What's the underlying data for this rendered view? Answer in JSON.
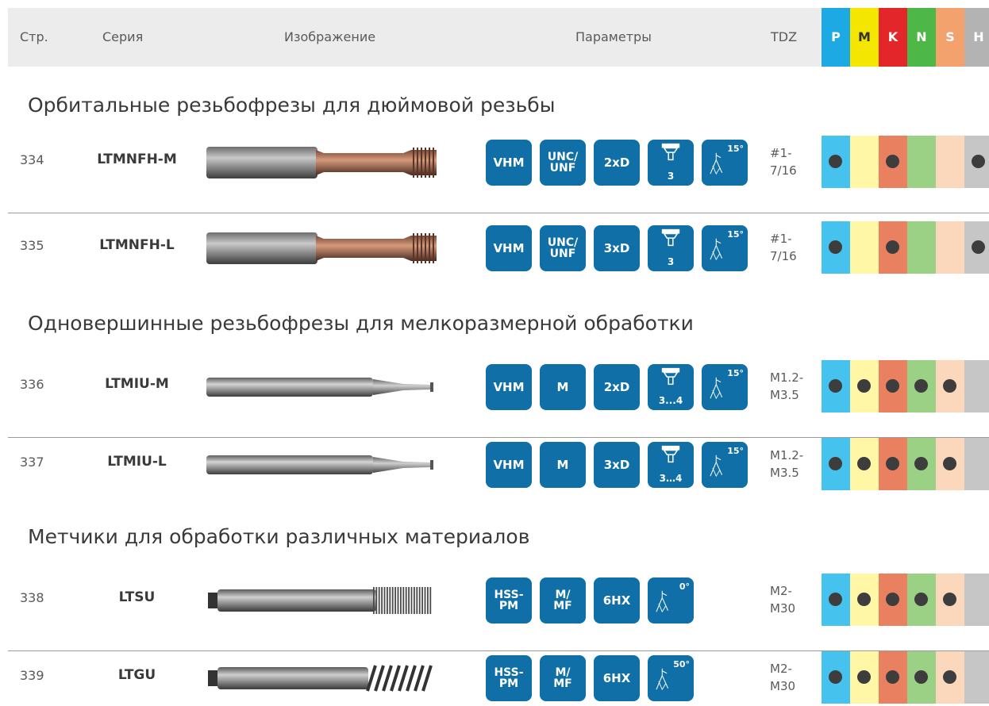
{
  "header": {
    "page": "Стр.",
    "series": "Серия",
    "image": "Изображение",
    "params": "Параметры",
    "tdz": "TDZ",
    "materials": [
      "P",
      "M",
      "K",
      "N",
      "S",
      "H"
    ]
  },
  "colors": {
    "head": [
      "#1ca9e4",
      "#f5e600",
      "#e3262a",
      "#4db848",
      "#f4a26d",
      "#b3b3b3"
    ],
    "cell": [
      "#45c3ee",
      "#fff6a6",
      "#e9805f",
      "#9bd185",
      "#fbd8bc",
      "#c6c6c6"
    ],
    "badge": "#0f6fa6"
  },
  "sections": [
    {
      "title": "Орбитальные резьбофрезы для дюймовой резьбы"
    },
    {
      "title": "Одновершинные резьбофрезы для мелкоразмерной обработки"
    },
    {
      "title": "Метчики для обработки различных материалов"
    }
  ],
  "rows": [
    {
      "page": "334",
      "series": "LTMNFH-M",
      "tool_icon": "thread-mill-icon",
      "badges": [
        "VHM",
        "UNC/ UNF",
        "2xD"
      ],
      "flutes": "3",
      "angle": "15°",
      "tdz": [
        "#1-",
        "7/16"
      ],
      "dots": [
        true,
        false,
        true,
        false,
        false,
        true
      ]
    },
    {
      "page": "335",
      "series": "LTMNFH-L",
      "tool_icon": "thread-mill-icon",
      "badges": [
        "VHM",
        "UNC/ UNF",
        "3xD"
      ],
      "flutes": "3",
      "angle": "15°",
      "tdz": [
        "#1-",
        "7/16"
      ],
      "dots": [
        true,
        false,
        true,
        false,
        false,
        true
      ]
    },
    {
      "page": "336",
      "series": "LTMIU-M",
      "tool_icon": "single-point-mill-icon",
      "badges": [
        "VHM",
        "M",
        "2xD"
      ],
      "flutes": "3...4",
      "angle": "15°",
      "tdz": [
        "M1.2-",
        "M3.5"
      ],
      "dots": [
        true,
        true,
        true,
        true,
        true,
        false
      ]
    },
    {
      "page": "337",
      "series": "LTMIU-L",
      "tool_icon": "single-point-mill-icon",
      "badges": [
        "VHM",
        "M",
        "3xD"
      ],
      "flutes": "3…4",
      "angle": "15°",
      "tdz": [
        "M1.2-",
        "M3.5"
      ],
      "dots": [
        true,
        true,
        true,
        true,
        true,
        false
      ]
    },
    {
      "page": "338",
      "series": "LTSU",
      "tool_icon": "straight-tap-icon",
      "badges": [
        "HSS- PM",
        "M/ MF",
        "6HX"
      ],
      "flutes": "",
      "angle": "0°",
      "tdz": [
        "M2-",
        "M30"
      ],
      "dots": [
        true,
        true,
        true,
        true,
        true,
        false
      ]
    },
    {
      "page": "339",
      "series": "LTGU",
      "tool_icon": "spiral-tap-icon",
      "badges": [
        "HSS- PM",
        "M/ MF",
        "6HX"
      ],
      "flutes": "",
      "angle": "50°",
      "tdz": [
        "M2-",
        "M30"
      ],
      "dots": [
        true,
        true,
        true,
        true,
        true,
        false
      ]
    }
  ]
}
